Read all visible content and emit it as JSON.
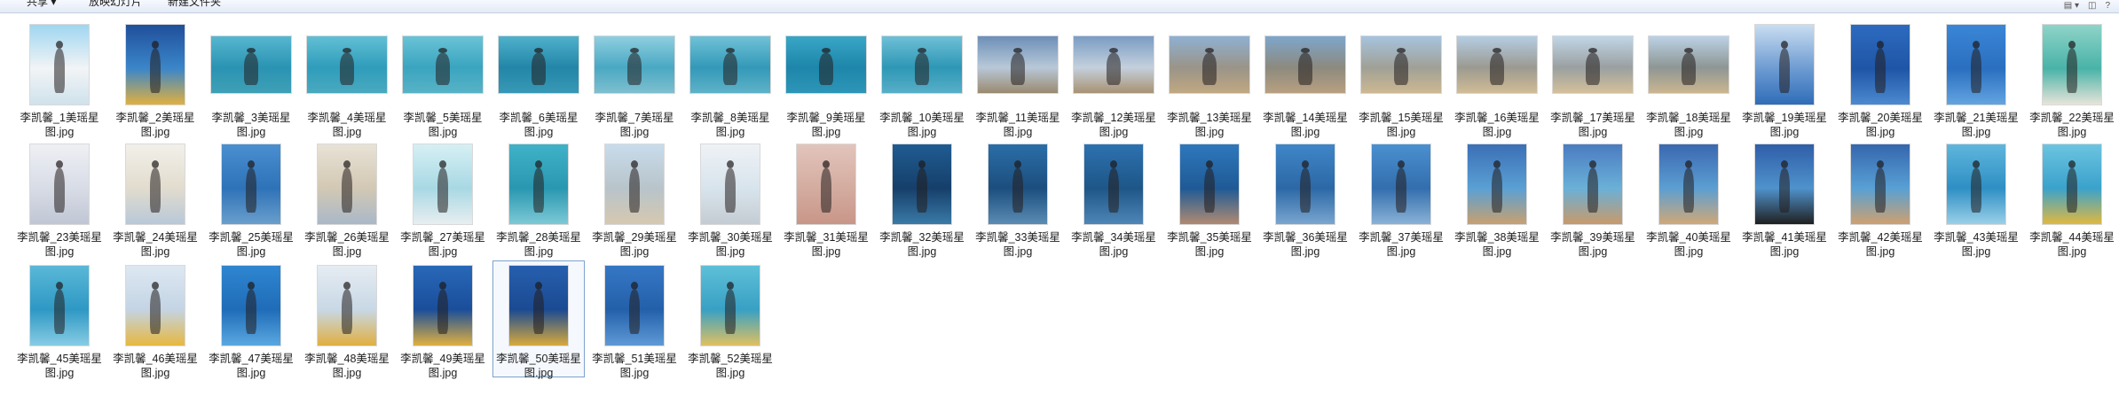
{
  "toolbar": {
    "share_label": "共享 ▾",
    "slideshow_label": "放映幻灯片",
    "new_folder_label": "新建文件夹",
    "view_icon": "view-options-icon",
    "preview_icon": "preview-pane-icon"
  },
  "files": [
    {
      "line1": "李凯馨_1美瑶星",
      "line2": "图.jpg",
      "o": "p",
      "c": [
        "#9fd6f0",
        "#f2f4f6",
        "#cfe2ec"
      ]
    },
    {
      "line1": "李凯馨_2美瑶星",
      "line2": "图.jpg",
      "o": "p",
      "c": [
        "#1f4f9a",
        "#3b86c9",
        "#e0b040"
      ]
    },
    {
      "line1": "李凯馨_3美瑶星",
      "line2": "图.jpg",
      "o": "l",
      "c": [
        "#57b7cf",
        "#2a93b3",
        "#3fa0b6"
      ]
    },
    {
      "line1": "李凯馨_4美瑶星",
      "line2": "图.jpg",
      "o": "l",
      "c": [
        "#62bfd4",
        "#2f9dbb",
        "#4aa9bf"
      ]
    },
    {
      "line1": "李凯馨_5美瑶星",
      "line2": "图.jpg",
      "o": "l",
      "c": [
        "#6ac3d6",
        "#3aa4c0",
        "#58b3c6"
      ]
    },
    {
      "line1": "李凯馨_6美瑶星",
      "line2": "图.jpg",
      "o": "l",
      "c": [
        "#4fb1cb",
        "#2386a8",
        "#3898b6"
      ]
    },
    {
      "line1": "李凯馨_7美瑶星",
      "line2": "图.jpg",
      "o": "l",
      "c": [
        "#8fcfe0",
        "#4aa8c3",
        "#7fbfcf"
      ]
    },
    {
      "line1": "李凯馨_8美瑶星",
      "line2": "图.jpg",
      "o": "l",
      "c": [
        "#70c2d7",
        "#3399b8",
        "#5eb2c8"
      ]
    },
    {
      "line1": "李凯馨_9美瑶星",
      "line2": "图.jpg",
      "o": "l",
      "c": [
        "#3aa6c6",
        "#1d86aa",
        "#2d96b8"
      ]
    },
    {
      "line1": "李凯馨_10美瑶星",
      "line2": "图.jpg",
      "o": "l",
      "c": [
        "#6fc0d6",
        "#2e97b6",
        "#58afc7"
      ]
    },
    {
      "line1": "李凯馨_11美瑶星",
      "line2": "图.jpg",
      "o": "l",
      "c": [
        "#6c8fb8",
        "#b8c8d8",
        "#9a8a70"
      ]
    },
    {
      "line1": "李凯馨_12美瑶星",
      "line2": "图.jpg",
      "o": "l",
      "c": [
        "#7a9cc4",
        "#c4d0dc",
        "#a89274"
      ]
    },
    {
      "line1": "李凯馨_13美瑶星",
      "line2": "图.jpg",
      "o": "l",
      "c": [
        "#8fb0d2",
        "#9a9488",
        "#c0a882"
      ]
    },
    {
      "line1": "李凯馨_14美瑶星",
      "line2": "图.jpg",
      "o": "l",
      "c": [
        "#7ea6cc",
        "#8c8a7e",
        "#b8a080"
      ]
    },
    {
      "line1": "李凯馨_15美瑶星",
      "line2": "图.jpg",
      "o": "l",
      "c": [
        "#a6c4de",
        "#a0a096",
        "#cdb892"
      ]
    },
    {
      "line1": "李凯馨_16美瑶星",
      "line2": "图.jpg",
      "o": "l",
      "c": [
        "#b4cde3",
        "#9c9a90",
        "#d0bc96"
      ]
    },
    {
      "line1": "李凯馨_17美瑶星",
      "line2": "图.jpg",
      "o": "l",
      "c": [
        "#c1d6e8",
        "#9aa0a0",
        "#d4c09a"
      ]
    },
    {
      "line1": "李凯馨_18美瑶星",
      "line2": "图.jpg",
      "o": "l",
      "c": [
        "#bcd2e6",
        "#8e9694",
        "#cbb690"
      ]
    },
    {
      "line1": "李凯馨_19美瑶星",
      "line2": "图.jpg",
      "o": "p",
      "c": [
        "#c9ddf0",
        "#6d9bd2",
        "#2f6db8"
      ]
    },
    {
      "line1": "李凯馨_20美瑶星",
      "line2": "图.jpg",
      "o": "p",
      "c": [
        "#2d6bc0",
        "#1f55a6",
        "#4c8ad0"
      ]
    },
    {
      "line1": "李凯馨_21美瑶星",
      "line2": "图.jpg",
      "o": "p",
      "c": [
        "#3b86d6",
        "#2a6fc0",
        "#63a4e0"
      ]
    },
    {
      "line1": "李凯馨_22美瑶星",
      "line2": "图.jpg",
      "o": "p",
      "c": [
        "#8fd3c8",
        "#49b3a8",
        "#e8e4d8"
      ]
    },
    {
      "line1": "李凯馨_23美瑶星",
      "line2": "图.jpg",
      "o": "p",
      "c": [
        "#eef0f4",
        "#d8dce6",
        "#c0c6d4"
      ]
    },
    {
      "line1": "李凯馨_24美瑶星",
      "line2": "图.jpg",
      "o": "p",
      "c": [
        "#f2f0ea",
        "#e2dcce",
        "#b8c8d8"
      ]
    },
    {
      "line1": "李凯馨_25美瑶星",
      "line2": "图.jpg",
      "o": "p",
      "c": [
        "#4a8fd0",
        "#2e72b8",
        "#6a9fcc"
      ]
    },
    {
      "line1": "李凯馨_26美瑶星",
      "line2": "图.jpg",
      "o": "p",
      "c": [
        "#e8e2d6",
        "#d2c8b4",
        "#aab8c8"
      ]
    },
    {
      "line1": "李凯馨_27美瑶星",
      "line2": "图.jpg",
      "o": "p",
      "c": [
        "#d6f0f4",
        "#a8d8e4",
        "#e8eef0"
      ]
    },
    {
      "line1": "李凯馨_28美瑶星",
      "line2": "图.jpg",
      "o": "p",
      "c": [
        "#3fb2c8",
        "#2a97b0",
        "#7cc9d6"
      ]
    },
    {
      "line1": "李凯馨_29美瑶星",
      "line2": "图.jpg",
      "o": "p",
      "c": [
        "#c8dcec",
        "#b8c4ca",
        "#d6c8b0"
      ]
    },
    {
      "line1": "李凯馨_30美瑶星",
      "line2": "图.jpg",
      "o": "p",
      "c": [
        "#eef2f6",
        "#d8e4ec",
        "#c4ccd2"
      ]
    },
    {
      "line1": "李凯馨_31美瑶星",
      "line2": "图.jpg",
      "o": "p",
      "c": [
        "#e2c4bc",
        "#d4aca0",
        "#c89688"
      ]
    },
    {
      "line1": "李凯馨_32美瑶星",
      "line2": "图.jpg",
      "o": "p",
      "c": [
        "#1f5c92",
        "#163f6a",
        "#3a7aa8"
      ]
    },
    {
      "line1": "李凯馨_33美瑶星",
      "line2": "图.jpg",
      "o": "p",
      "c": [
        "#2a6ea8",
        "#1c4e7e",
        "#5a8cb4"
      ]
    },
    {
      "line1": "李凯馨_34美瑶星",
      "line2": "图.jpg",
      "o": "p",
      "c": [
        "#2c72b0",
        "#1e5688",
        "#4e86b8"
      ]
    },
    {
      "line1": "李凯馨_35美瑶星",
      "line2": "图.jpg",
      "o": "p",
      "c": [
        "#2e78bc",
        "#1f5a96",
        "#b08a72"
      ]
    },
    {
      "line1": "李凯馨_36美瑶星",
      "line2": "图.jpg",
      "o": "p",
      "c": [
        "#3f86c8",
        "#2c68a6",
        "#7aa6d0"
      ]
    },
    {
      "line1": "李凯馨_37美瑶星",
      "line2": "图.jpg",
      "o": "p",
      "c": [
        "#4a90d0",
        "#336eae",
        "#8ab2d6"
      ]
    },
    {
      "line1": "李凯馨_38美瑶星",
      "line2": "图.jpg",
      "o": "p",
      "c": [
        "#3b6fb6",
        "#5aa0d4",
        "#c8a070"
      ]
    },
    {
      "line1": "李凯馨_39美瑶星",
      "line2": "图.jpg",
      "o": "p",
      "c": [
        "#4a7cc0",
        "#6ab0d8",
        "#c89a6a"
      ]
    },
    {
      "line1": "李凯馨_40美瑶星",
      "line2": "图.jpg",
      "o": "p",
      "c": [
        "#3a68b0",
        "#5c9ed2",
        "#d0a878"
      ]
    },
    {
      "line1": "李凯馨_41美瑶星",
      "line2": "图.jpg",
      "o": "p",
      "c": [
        "#2f5ea8",
        "#4f92cc",
        "#202020"
      ]
    },
    {
      "line1": "李凯馨_42美瑶星",
      "line2": "图.jpg",
      "o": "p",
      "c": [
        "#3566ae",
        "#58a0d4",
        "#cfa070"
      ]
    },
    {
      "line1": "李凯馨_43美瑶星",
      "line2": "图.jpg",
      "o": "p",
      "c": [
        "#5fb6dc",
        "#2e8fc4",
        "#9ad0e8"
      ]
    },
    {
      "line1": "李凯馨_44美瑶星",
      "line2": "图.jpg",
      "o": "p",
      "c": [
        "#6cc4e0",
        "#3aa2cc",
        "#e0b840"
      ]
    },
    {
      "line1": "李凯馨_45美瑶星",
      "line2": "图.jpg",
      "o": "p",
      "c": [
        "#5ab8d8",
        "#2e98c4",
        "#88cce4"
      ]
    },
    {
      "line1": "李凯馨_46美瑶星",
      "line2": "图.jpg",
      "o": "p",
      "c": [
        "#dde8f2",
        "#c4d4e4",
        "#e6b840"
      ]
    },
    {
      "line1": "李凯馨_47美瑶星",
      "line2": "图.jpg",
      "o": "p",
      "c": [
        "#2f86d0",
        "#1f6cb8",
        "#5aa8e0"
      ]
    },
    {
      "line1": "李凯馨_48美瑶星",
      "line2": "图.jpg",
      "o": "p",
      "c": [
        "#e6ecf2",
        "#c8d8e6",
        "#e0b040"
      ]
    },
    {
      "line1": "李凯馨_49美瑶星",
      "line2": "图.jpg",
      "o": "p",
      "c": [
        "#2868b8",
        "#1a4e9a",
        "#e0b040"
      ]
    },
    {
      "line1": "李凯馨_50美瑶星",
      "line2": "图.jpg",
      "o": "p",
      "c": [
        "#275fae",
        "#1b4a92",
        "#d8aa3c"
      ],
      "selected": true
    },
    {
      "line1": "李凯馨_51美瑶星",
      "line2": "图.jpg",
      "o": "p",
      "c": [
        "#3577c4",
        "#2460aa",
        "#5e9ad6"
      ]
    },
    {
      "line1": "李凯馨_52美瑶星",
      "line2": "图.jpg",
      "o": "p",
      "c": [
        "#5ec0d8",
        "#38a0c4",
        "#e0c060"
      ]
    }
  ]
}
